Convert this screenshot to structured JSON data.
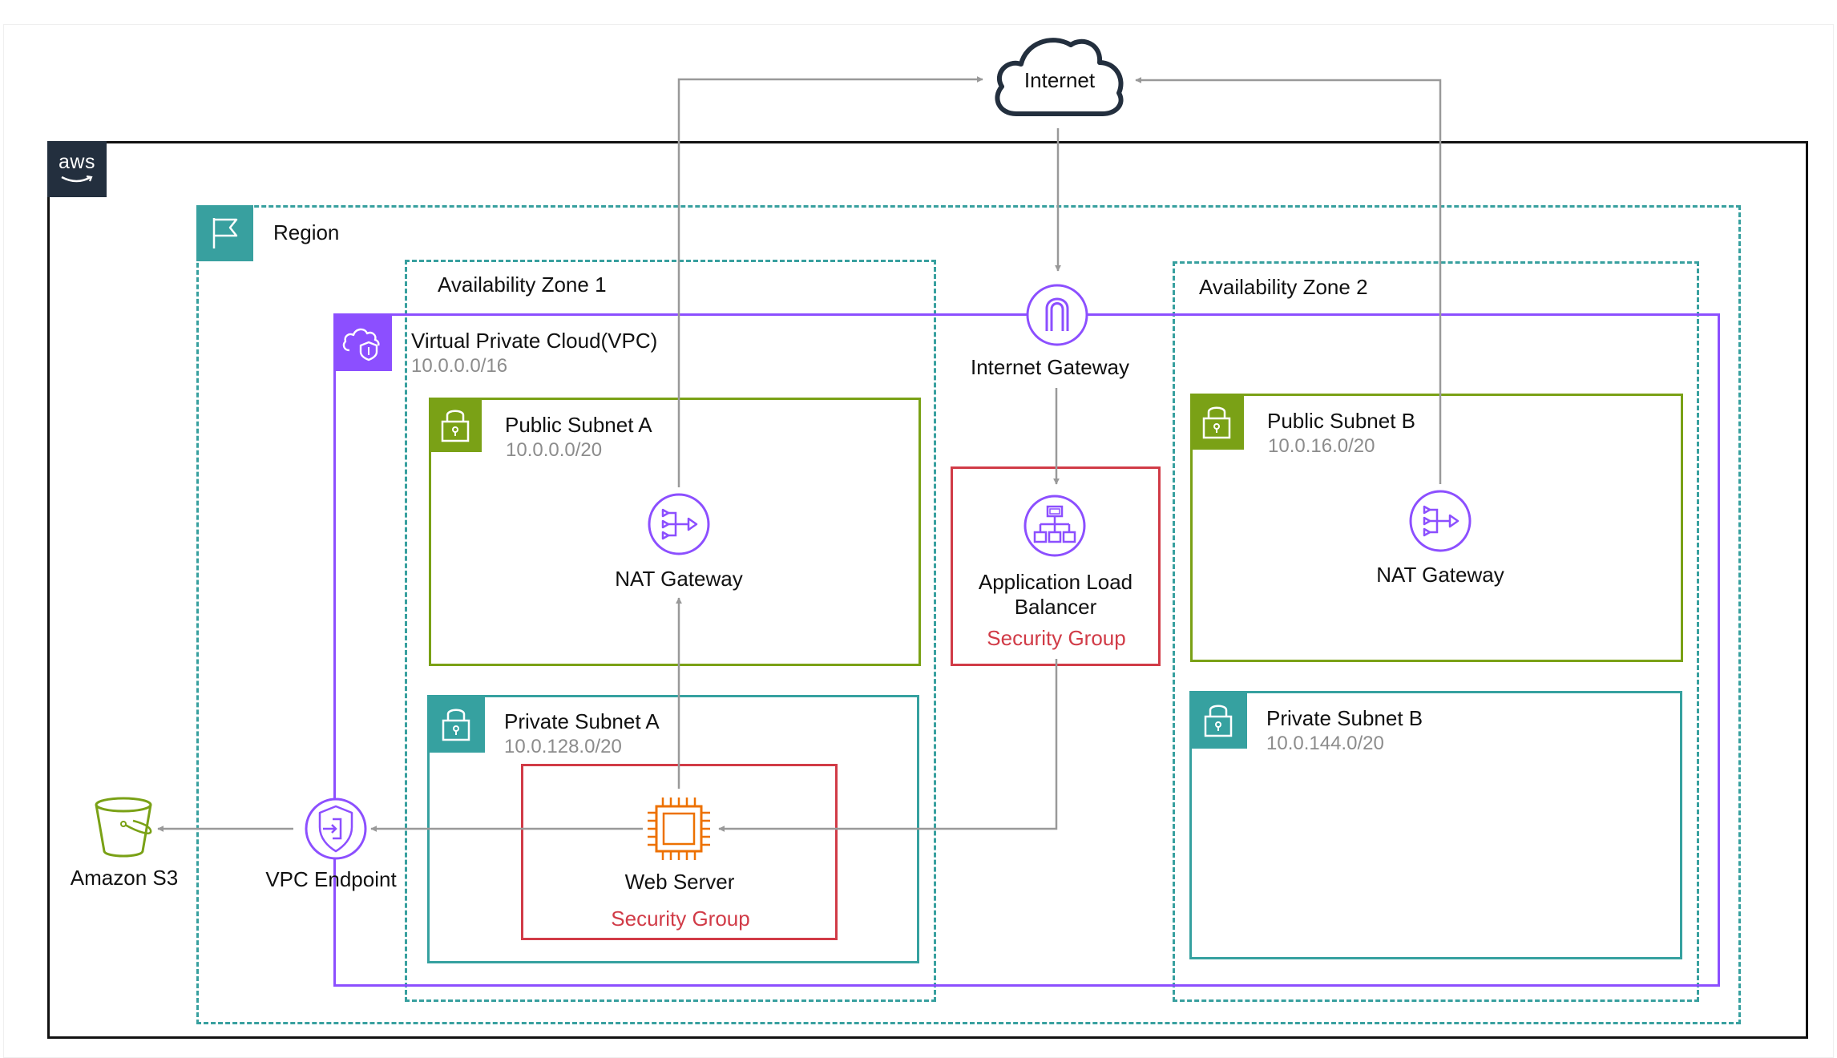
{
  "internet": {
    "label": "Internet"
  },
  "aws_cloud": {
    "logo_text": "aws"
  },
  "region": {
    "label": "Region"
  },
  "availability_zone_1": {
    "label": "Availability Zone 1"
  },
  "availability_zone_2": {
    "label": "Availability Zone 2"
  },
  "vpc": {
    "label": "Virtual Private Cloud(VPC)",
    "cidr": "10.0.0.0/16"
  },
  "internet_gateway": {
    "label": "Internet Gateway"
  },
  "public_subnet_a": {
    "label": "Public Subnet A",
    "cidr": "10.0.0.0/20"
  },
  "public_subnet_b": {
    "label": "Public Subnet B",
    "cidr": "10.0.16.0/20"
  },
  "private_subnet_a": {
    "label": "Private Subnet A",
    "cidr": "10.0.128.0/20"
  },
  "private_subnet_b": {
    "label": "Private Subnet B",
    "cidr": "10.0.144.0/20"
  },
  "nat_gateway_a": {
    "label": "NAT Gateway"
  },
  "nat_gateway_b": {
    "label": "NAT Gateway"
  },
  "load_balancer": {
    "label_line1": "Application Load",
    "label_line2": "Balancer",
    "security_group": "Security Group"
  },
  "web_server": {
    "label": "Web Server",
    "security_group": "Security Group"
  },
  "vpc_endpoint": {
    "label": "VPC Endpoint"
  },
  "amazon_s3": {
    "label": "Amazon S3"
  },
  "colors": {
    "aws_border": "#111111",
    "aws_logo_bg": "#232f3e",
    "region_teal": "#38a09f",
    "vpc_purple": "#8c4fff",
    "public_subnet_green": "#7aa116",
    "private_subnet_teal": "#36a1a0",
    "security_group_red": "#d13b47",
    "ec2_orange": "#ed7100",
    "s3_green": "#7aa116",
    "arrow_gray": "#999999"
  }
}
